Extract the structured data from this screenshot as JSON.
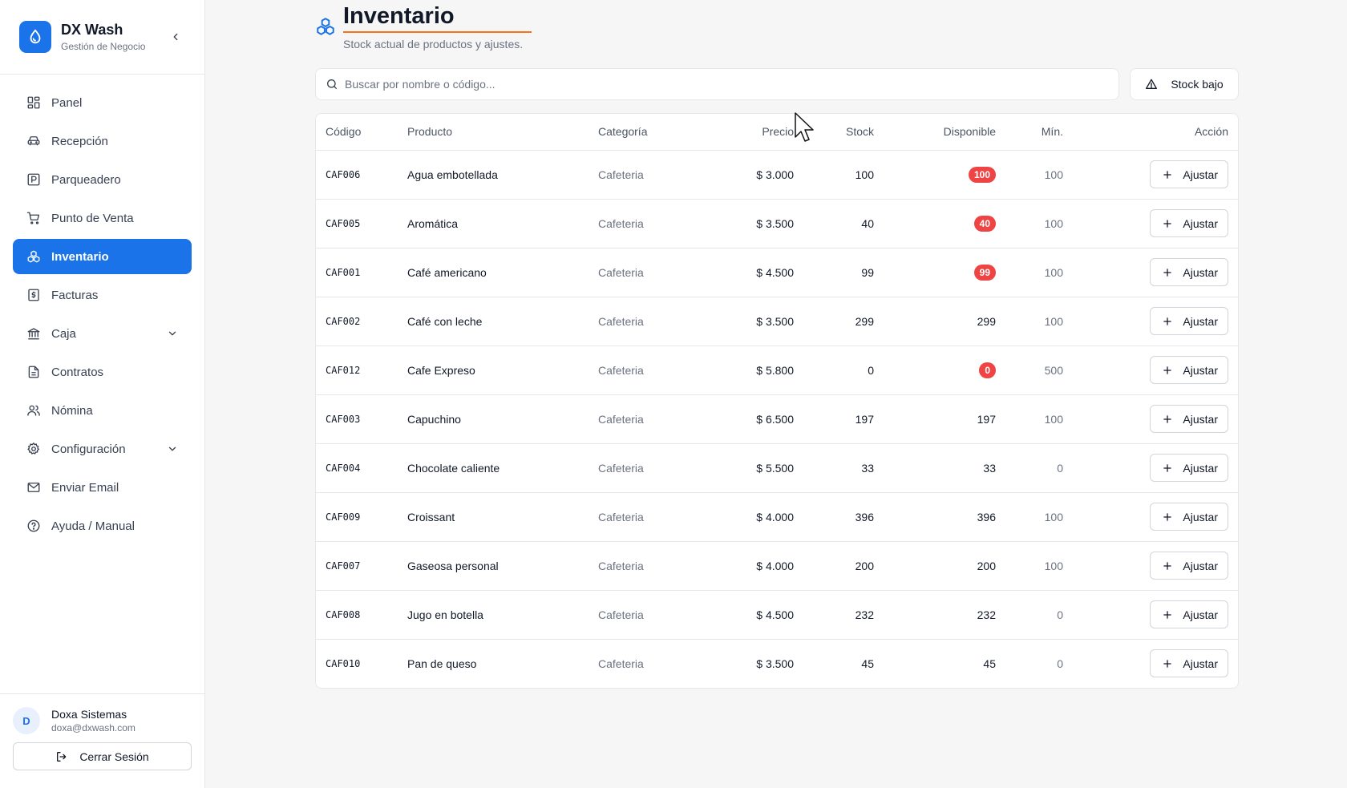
{
  "brand": {
    "name": "DX Wash",
    "subtitle": "Gestión de Negocio"
  },
  "sidebar": {
    "items": [
      {
        "label": "Panel",
        "icon": "grid-icon",
        "active": false
      },
      {
        "label": "Recepción",
        "icon": "car-icon",
        "active": false
      },
      {
        "label": "Parqueadero",
        "icon": "parking-icon",
        "active": false
      },
      {
        "label": "Punto de Venta",
        "icon": "cart-icon",
        "active": false
      },
      {
        "label": "Inventario",
        "icon": "boxes-icon",
        "active": true
      },
      {
        "label": "Facturas",
        "icon": "receipt-icon",
        "active": false
      },
      {
        "label": "Caja",
        "icon": "bank-icon",
        "active": false,
        "expandable": true
      },
      {
        "label": "Contratos",
        "icon": "document-icon",
        "active": false
      },
      {
        "label": "Nómina",
        "icon": "users-icon",
        "active": false
      },
      {
        "label": "Configuración",
        "icon": "gear-icon",
        "active": false,
        "expandable": true
      },
      {
        "label": "Enviar Email",
        "icon": "mail-icon",
        "active": false
      },
      {
        "label": "Ayuda / Manual",
        "icon": "help-icon",
        "active": false
      }
    ]
  },
  "user": {
    "initial": "D",
    "name": "Doxa Sistemas",
    "email": "doxa@dxwash.com",
    "logout_label": "Cerrar Sesión"
  },
  "page": {
    "title": "Inventario",
    "subtitle": "Stock actual de productos y ajustes."
  },
  "search": {
    "placeholder": "Buscar por nombre o código...",
    "value": ""
  },
  "low_stock_label": "Stock bajo",
  "table": {
    "headers": {
      "code": "Código",
      "product": "Producto",
      "category": "Categoría",
      "price": "Precio",
      "stock": "Stock",
      "available": "Disponible",
      "min": "Mín.",
      "action": "Acción"
    },
    "action_label": "Ajustar",
    "rows": [
      {
        "code": "CAF006",
        "product": "Agua embotellada",
        "category": "Cafeteria",
        "price": "$ 3.000",
        "stock": "100",
        "available": "100",
        "low": true,
        "min": "100"
      },
      {
        "code": "CAF005",
        "product": "Aromática",
        "category": "Cafeteria",
        "price": "$ 3.500",
        "stock": "40",
        "available": "40",
        "low": true,
        "min": "100"
      },
      {
        "code": "CAF001",
        "product": "Café americano",
        "category": "Cafeteria",
        "price": "$ 4.500",
        "stock": "99",
        "available": "99",
        "low": true,
        "min": "100"
      },
      {
        "code": "CAF002",
        "product": "Café con leche",
        "category": "Cafeteria",
        "price": "$ 3.500",
        "stock": "299",
        "available": "299",
        "low": false,
        "min": "100"
      },
      {
        "code": "CAF012",
        "product": "Cafe Expreso",
        "category": "Cafeteria",
        "price": "$ 5.800",
        "stock": "0",
        "available": "0",
        "low": true,
        "min": "500"
      },
      {
        "code": "CAF003",
        "product": "Capuchino",
        "category": "Cafeteria",
        "price": "$ 6.500",
        "stock": "197",
        "available": "197",
        "low": false,
        "min": "100"
      },
      {
        "code": "CAF004",
        "product": "Chocolate caliente",
        "category": "Cafeteria",
        "price": "$ 5.500",
        "stock": "33",
        "available": "33",
        "low": false,
        "min": "0"
      },
      {
        "code": "CAF009",
        "product": "Croissant",
        "category": "Cafeteria",
        "price": "$ 4.000",
        "stock": "396",
        "available": "396",
        "low": false,
        "min": "100"
      },
      {
        "code": "CAF007",
        "product": "Gaseosa personal",
        "category": "Cafeteria",
        "price": "$ 4.000",
        "stock": "200",
        "available": "200",
        "low": false,
        "min": "100"
      },
      {
        "code": "CAF008",
        "product": "Jugo en botella",
        "category": "Cafeteria",
        "price": "$ 4.500",
        "stock": "232",
        "available": "232",
        "low": false,
        "min": "0"
      },
      {
        "code": "CAF010",
        "product": "Pan de queso",
        "category": "Cafeteria",
        "price": "$ 3.500",
        "stock": "45",
        "available": "45",
        "low": false,
        "min": "0"
      }
    ]
  },
  "colors": {
    "primary": "#1a73e8",
    "accent_underline": "#f97316",
    "danger": "#ef4444"
  }
}
